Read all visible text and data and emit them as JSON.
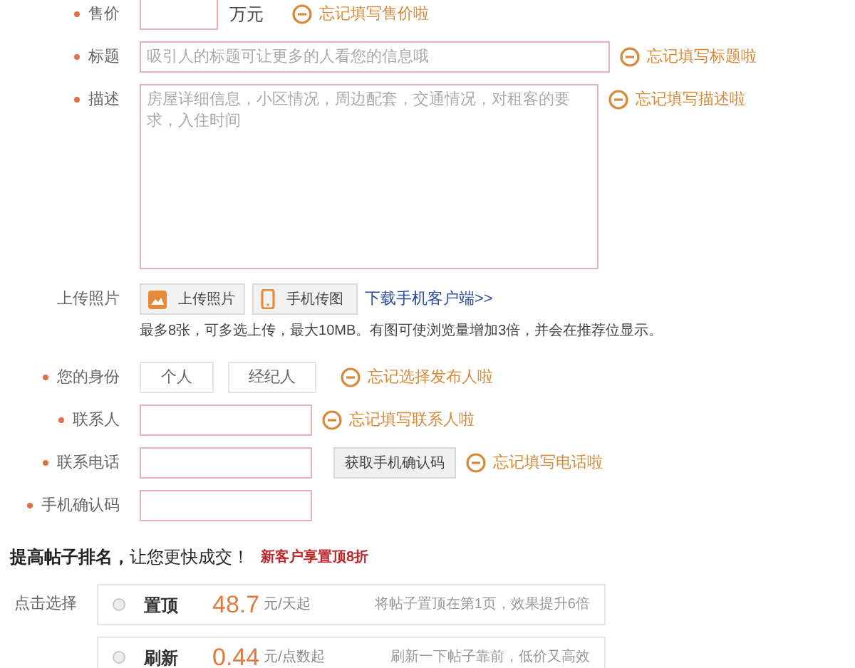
{
  "rows": [
    {
      "kind": "price",
      "label": "售价",
      "required": true,
      "unit": "万元",
      "error": "忘记填写售价啦"
    },
    {
      "kind": "text",
      "label": "标题",
      "required": true,
      "placeholder": "吸引人的标题可让更多的人看您的信息哦",
      "error": "忘记填写标题啦"
    },
    {
      "kind": "textarea",
      "label": "描述",
      "required": true,
      "placeholder": "房屋详细信息，小区情况，周边配套，交通情况，对租客的要求，入住时间",
      "error": "忘记填写描述啦"
    },
    {
      "kind": "upload",
      "label": "上传照片",
      "required": false,
      "buttons": [
        "上传照片",
        "手机传图"
      ],
      "link": "下载手机客户端>>",
      "hint": "最多8张，可多选上传，最大10MB。有图可使浏览量增加3倍，并会在推荐位显示。"
    },
    {
      "kind": "choice",
      "label": "您的身份",
      "required": true,
      "options": [
        {
          "label": "个人",
          "selected": false
        },
        {
          "label": "经纪人",
          "selected": false
        }
      ],
      "error": "忘记选择发布人啦"
    },
    {
      "kind": "input",
      "label": "联系人",
      "required": true,
      "error": "忘记填写联系人啦"
    },
    {
      "kind": "phone",
      "label": "联系电话",
      "required": true,
      "button": "获取手机确认码",
      "error": "忘记填写电话啦"
    },
    {
      "kind": "input",
      "label": "手机确认码",
      "required": true
    }
  ],
  "promote": {
    "heading": "**提高帖子排名，**让您更快成交！",
    "badge": "新客户享置顶8折",
    "label": "点击选择",
    "options": [
      {
        "name": "置顶",
        "price": "48.7",
        "unit": "元/天起",
        "description": "将帖子置顶在第1页，效果提升6倍",
        "selected": false
      },
      {
        "name": "刷新",
        "price": "0.44",
        "unit": "元/点数起",
        "description": "刷新一下帖子靠前，低价又高效",
        "selected": false
      }
    ]
  }
}
